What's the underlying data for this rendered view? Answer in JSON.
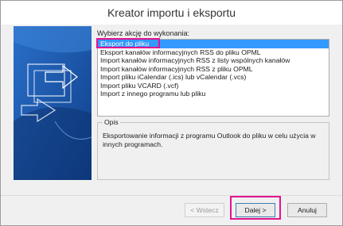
{
  "dialog": {
    "title": "Kreator importu i eksportu"
  },
  "prompt": "Wybierz akcję do wykonania:",
  "actions": [
    "Eksport do pliku",
    "Eksport kanałów informacyjnych RSS do pliku OPML",
    "Import kanałów informacyjnych RSS z listy wspólnych kanałów",
    "Import kanałów informacyjnych RSS z pliku OPML",
    "Import pliku iCalendar (.ics) lub vCalendar (.vcs)",
    "Import pliku VCARD (.vcf)",
    "Import z innego programu lub pliku"
  ],
  "selected_index": 0,
  "description": {
    "title": "Opis",
    "text": "Eksportowanie informacji z programu Outlook do pliku w celu użycia w innych programach."
  },
  "buttons": {
    "back": "< Wstecz",
    "next": "Dalej >",
    "cancel": "Anuluj"
  },
  "colors": {
    "highlight": "#e1138f",
    "selection": "#3399ff",
    "art_blue": "#1f5fb3"
  }
}
